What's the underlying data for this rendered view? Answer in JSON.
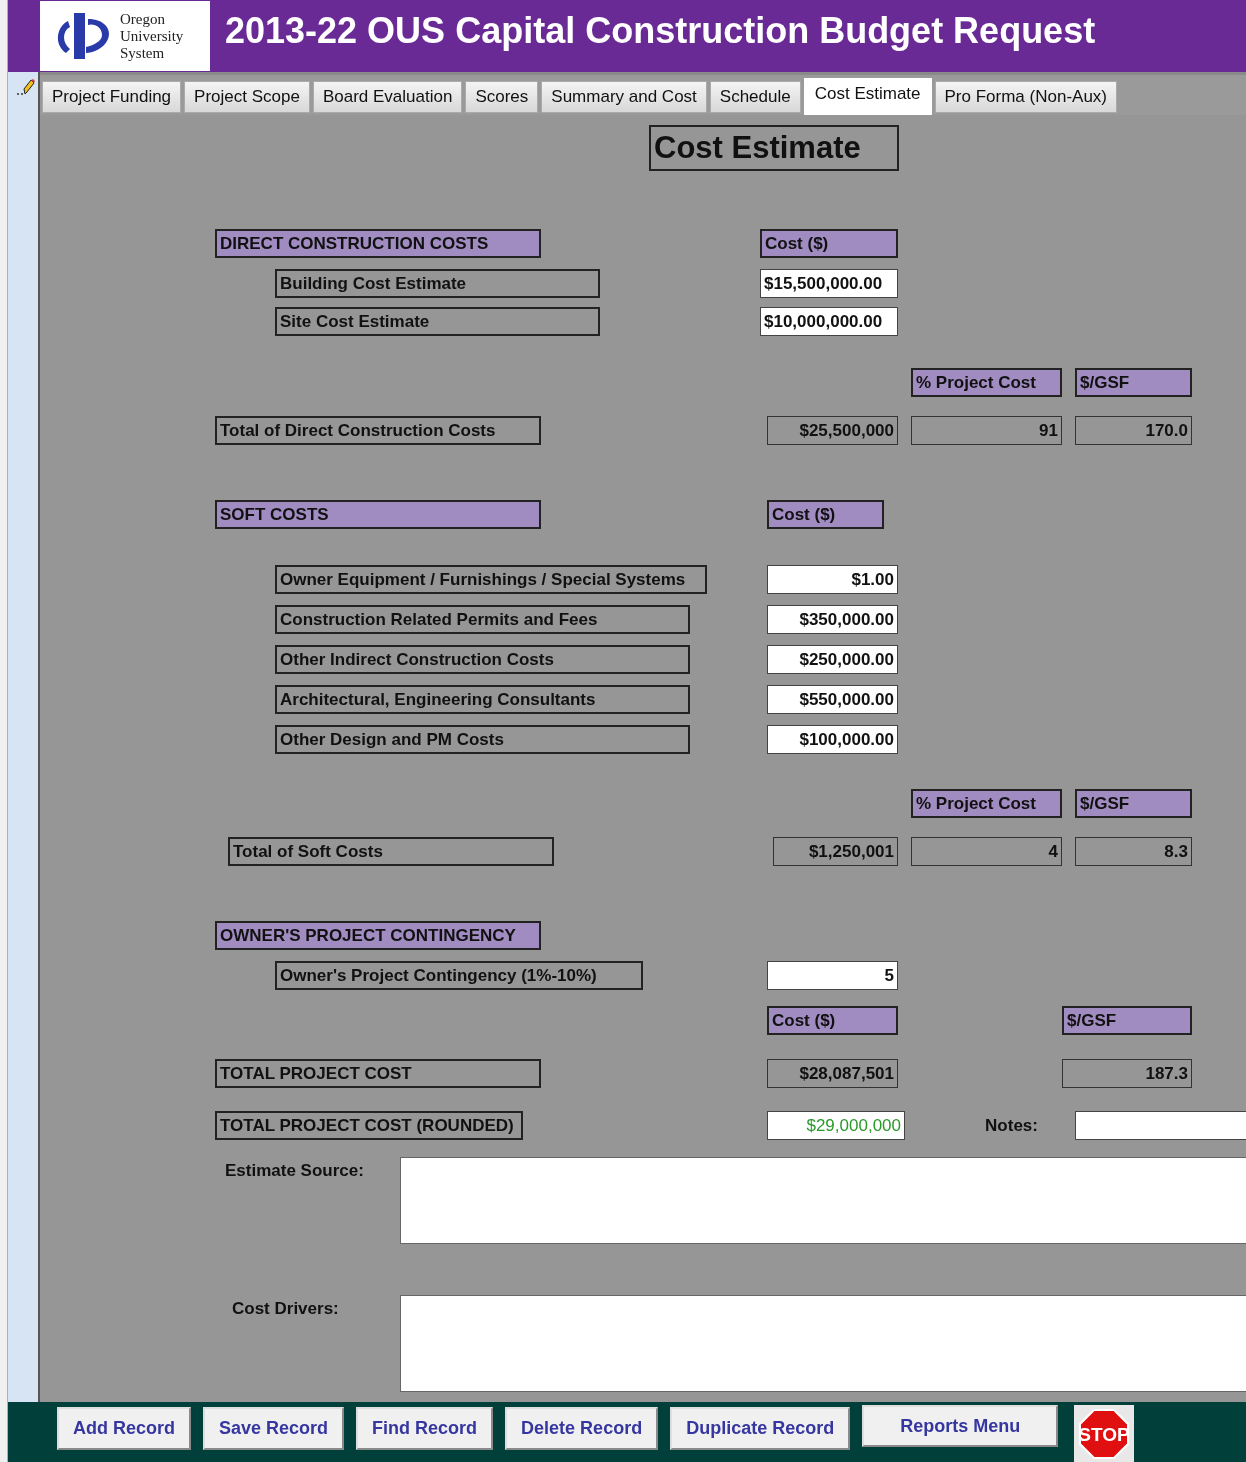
{
  "header": {
    "logo_lines": [
      "Oregon",
      "University",
      "System"
    ],
    "title": "2013-22 OUS Capital Construction Budget Request"
  },
  "tabs": [
    {
      "label": "Project Funding",
      "selected": false
    },
    {
      "label": "Project Scope",
      "selected": false
    },
    {
      "label": "Board Evaluation",
      "selected": false
    },
    {
      "label": "Scores",
      "selected": false
    },
    {
      "label": "Summary and Cost",
      "selected": false
    },
    {
      "label": "Schedule",
      "selected": false
    },
    {
      "label": "Cost Estimate",
      "selected": true
    },
    {
      "label": "Pro Forma (Non-Aux)",
      "selected": false
    }
  ],
  "form_title": "Cost Estimate",
  "direct": {
    "heading": "DIRECT CONSTRUCTION COSTS",
    "cost_heading": "Cost ($)",
    "items": [
      {
        "label": "Building Cost Estimate",
        "value": "$15,500,000.00"
      },
      {
        "label": "Site Cost Estimate",
        "value": "$10,000,000.00"
      }
    ],
    "percent_heading": "% Project Cost",
    "gsf_heading": "$/GSF",
    "total": {
      "label": "Total of Direct Construction Costs",
      "cost": "$25,500,000",
      "percent": "91",
      "gsf": "170.0"
    }
  },
  "soft": {
    "heading": "SOFT COSTS",
    "cost_heading": "Cost ($)",
    "items": [
      {
        "label": "Owner Equipment / Furnishings / Special Systems",
        "value": "$1.00"
      },
      {
        "label": "Construction Related Permits and Fees",
        "value": "$350,000.00"
      },
      {
        "label": "Other Indirect Construction Costs",
        "value": "$250,000.00"
      },
      {
        "label": "Architectural, Engineering Consultants",
        "value": "$550,000.00"
      },
      {
        "label": "Other Design and PM Costs",
        "value": "$100,000.00"
      }
    ],
    "percent_heading": "% Project Cost",
    "gsf_heading": "$/GSF",
    "total": {
      "label": "Total of Soft Costs",
      "cost": "$1,250,001",
      "percent": "4",
      "gsf": "8.3"
    }
  },
  "contingency": {
    "heading": "OWNER'S PROJECT CONTINGENCY",
    "item": {
      "label": "Owner's Project Contingency (1%-10%)",
      "value": "5"
    },
    "cost_heading": "Cost ($)",
    "gsf_heading": "$/GSF",
    "total": {
      "label": "TOTAL PROJECT COST",
      "cost": "$28,087,501",
      "gsf": "187.3"
    }
  },
  "rounded": {
    "label": "TOTAL PROJECT COST (ROUNDED)",
    "value": "$29,000,000"
  },
  "notes": {
    "label": "Notes:"
  },
  "estimate_source": {
    "label": "Estimate Source:"
  },
  "cost_drivers": {
    "label": "Cost Drivers:"
  },
  "buttons": [
    "Add Record",
    "Save Record",
    "Find Record",
    "Delete Record",
    "Duplicate Record",
    "Reports Menu"
  ],
  "stop": "STOP"
}
